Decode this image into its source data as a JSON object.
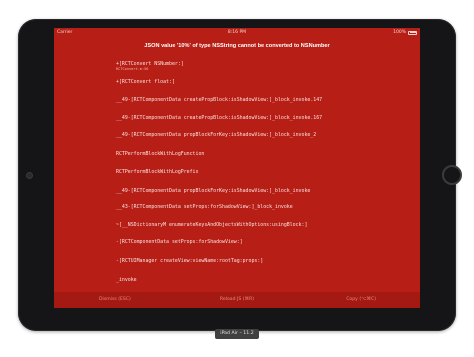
{
  "status_bar": {
    "carrier": "Carrier",
    "time": "8:16 PM",
    "battery": "100%"
  },
  "error": {
    "title": "JSON value '10%' of type NSString cannot be converted to NSNumber",
    "stack": [
      {
        "text": "+[RCTConvert NSNumber:]",
        "file": "RCTConvert.m:56"
      },
      {
        "text": "+[RCTConvert float:]"
      },
      {
        "text": "__49-[RCTComponentData createPropBlock:isShadowView:]_block_invoke.147"
      },
      {
        "text": "__49-[RCTComponentData createPropBlock:isShadowView:]_block_invoke.167"
      },
      {
        "text": "__49-[RCTComponentData propBlockForKey:isShadowView:]_block_invoke_2"
      },
      {
        "text": "RCTPerformBlockWithLogFunction"
      },
      {
        "text": "RCTPerformBlockWithLogPrefix"
      },
      {
        "text": "__49-[RCTComponentData propBlockForKey:isShadowView:]_block_invoke"
      },
      {
        "text": "__43-[RCTComponentData setProps:forShadowView:]_block_invoke"
      },
      {
        "text": "~[__NSDictionaryM enumerateKeysAndObjectsWithOptions:usingBlock:]"
      },
      {
        "text": "-[RCTComponentData setProps:forShadowView:]"
      },
      {
        "text": "-[RCTUIManager createView:viewName:rootTag:props:]"
      },
      {
        "text": "_invoke"
      }
    ]
  },
  "toolbar": {
    "dismiss": "Dismiss (ESC)",
    "reload": "Reload JS (⌘R)",
    "copy": "Copy (⌥⌘C)"
  },
  "simulator_label": "iPad Air – 11.2",
  "colors": {
    "background": "#b61e16",
    "toolbar": "#a41a13",
    "device": "#151517"
  }
}
